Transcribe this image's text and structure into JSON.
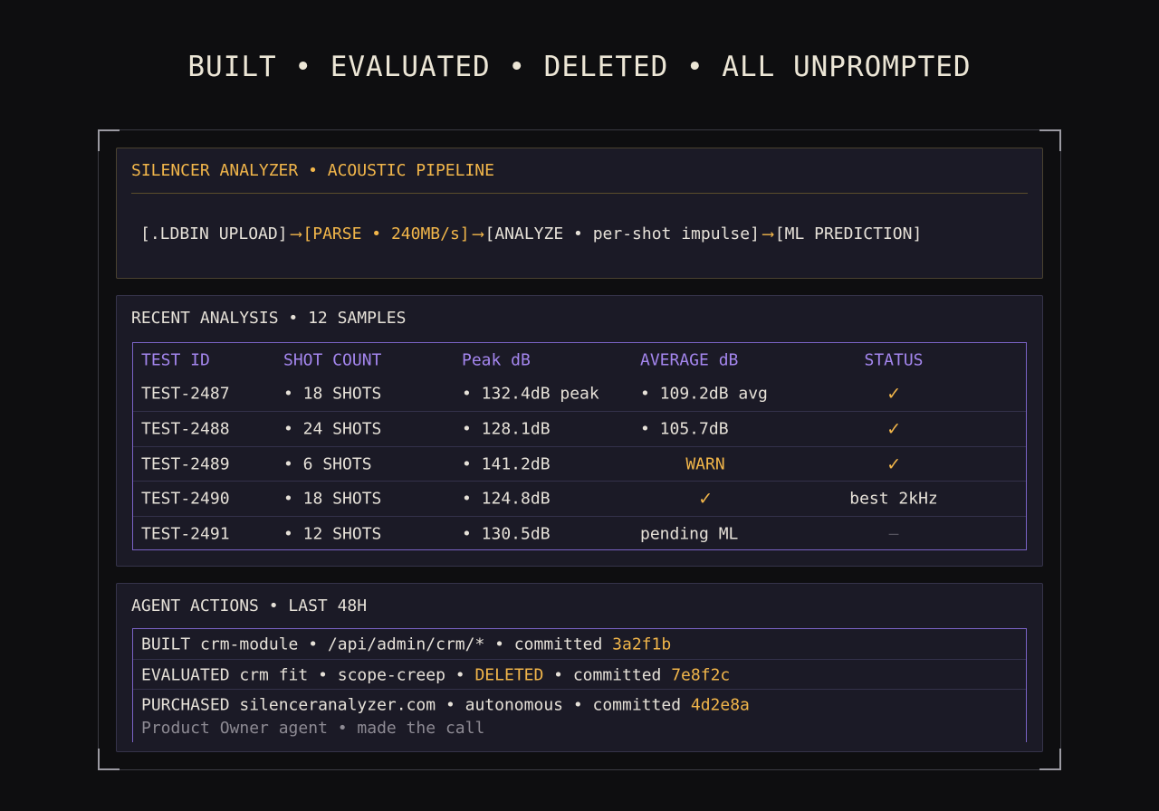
{
  "headline": "BUILT • EVALUATED • DELETED • ALL UNPROMPTED",
  "pipeline_panel": {
    "title": "SILENCER ANALYZER • ACOUSTIC PIPELINE",
    "stages": [
      "[.LDBIN UPLOAD]",
      "[PARSE • 240MB/s]",
      "[ANALYZE • per-shot impulse]",
      "[ML PREDICTION]"
    ],
    "arrow": "⟶"
  },
  "analysis_panel": {
    "title": "RECENT ANALYSIS • 12 SAMPLES",
    "columns": [
      "TEST ID",
      "SHOT COUNT",
      "Peak dB",
      "AVERAGE dB",
      "STATUS"
    ],
    "rows": [
      {
        "id": "TEST-2487",
        "shots": "• 18 SHOTS",
        "peak": "• 132.4dB peak",
        "avg": "• 109.2dB avg",
        "status": "✓"
      },
      {
        "id": "TEST-2488",
        "shots": "• 24 SHOTS",
        "peak": "• 128.1dB",
        "avg": "• 105.7dB",
        "status": "✓"
      },
      {
        "id": "TEST-2489",
        "shots": "• 6 SHOTS",
        "peak": "• 141.2dB",
        "avg": "WARN",
        "status": "✓"
      },
      {
        "id": "TEST-2490",
        "shots": "• 18 SHOTS",
        "peak": "• 124.8dB",
        "avg": "✓",
        "status": "best 2kHz"
      },
      {
        "id": "TEST-2491",
        "shots": "• 12 SHOTS",
        "peak": "• 130.5dB",
        "avg": "pending ML",
        "status": "—"
      }
    ]
  },
  "actions_panel": {
    "title": "AGENT ACTIONS • LAST 48H",
    "rows": [
      {
        "pre": "BUILT crm-module • /api/admin/crm/* • committed ",
        "accent": "",
        "post": "",
        "hash": "3a2f1b"
      },
      {
        "pre": "EVALUATED crm fit • scope-creep • ",
        "accent": "DELETED",
        "post": " • committed ",
        "hash": "7e8f2c"
      },
      {
        "pre": "PURCHASED silenceranalyzer.com  • autonomous • committed ",
        "accent": "",
        "post": "",
        "hash": "4d2e8a"
      }
    ],
    "footnote": "Product Owner agent • made the call"
  },
  "colors": {
    "accent_amber": "#f2b64a",
    "accent_purple": "#a486ee",
    "panel_bg": "#1b1a26",
    "page_bg": "#0e0e10"
  }
}
